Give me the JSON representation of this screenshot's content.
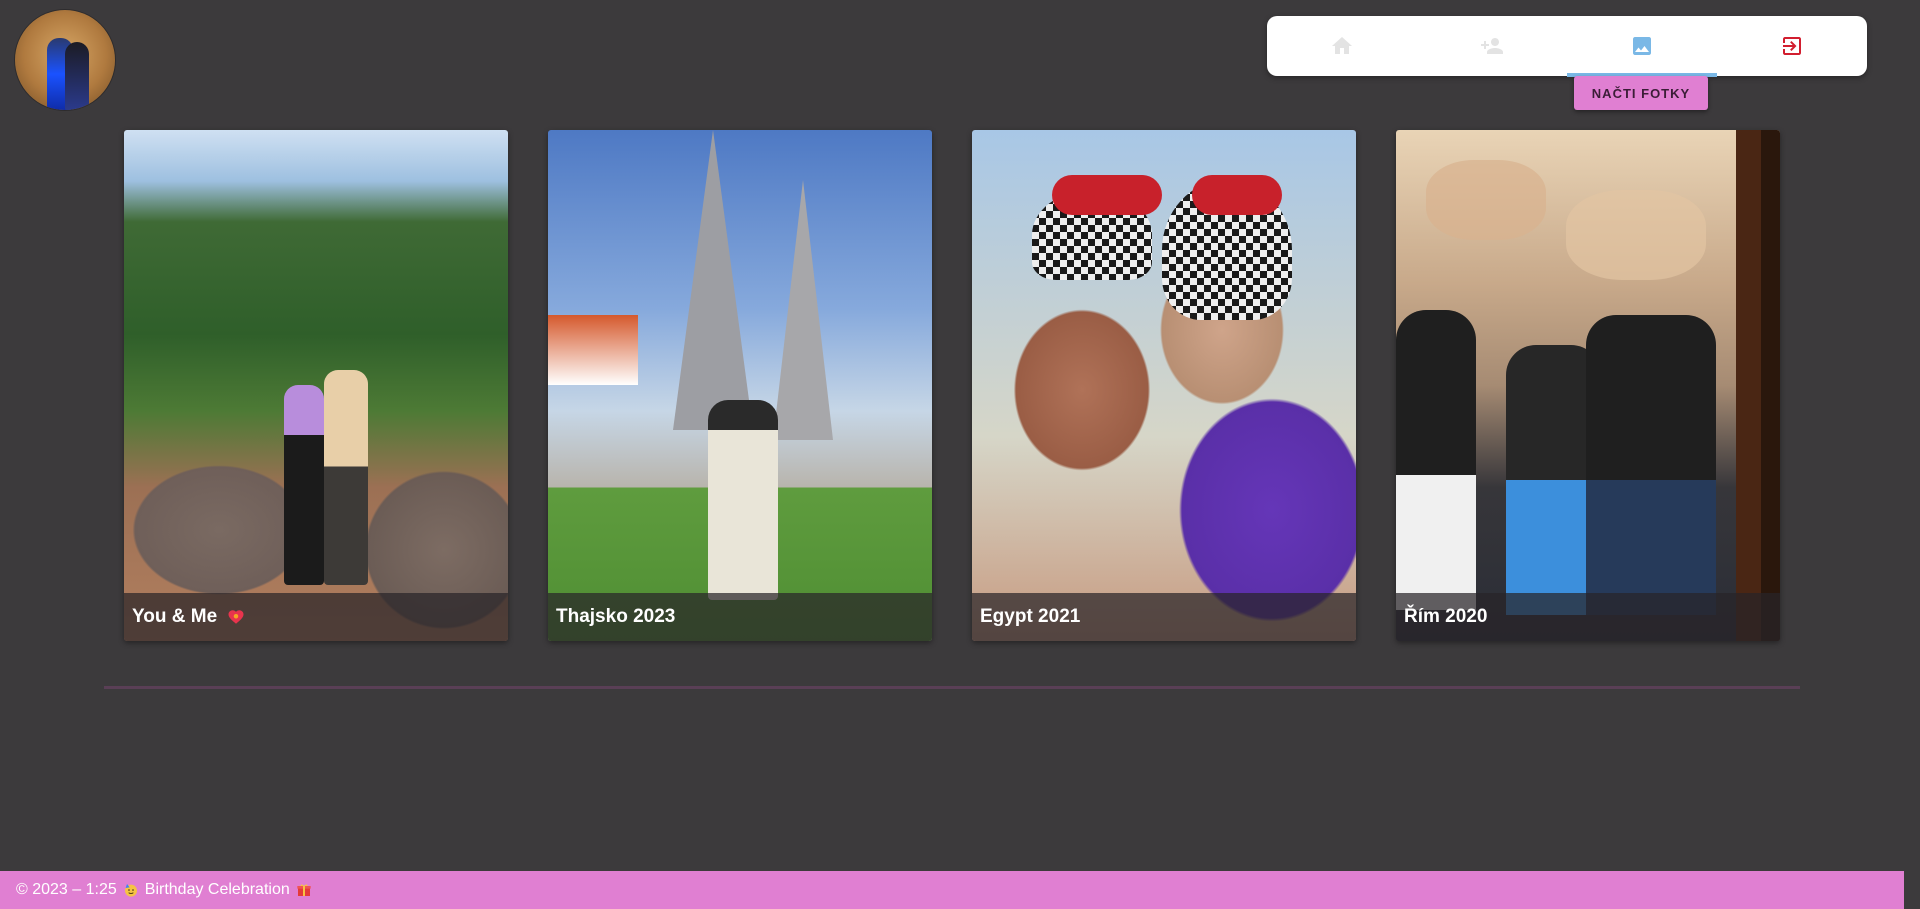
{
  "header": {
    "avatar_alt": "profile avatar"
  },
  "nav": {
    "items": [
      {
        "id": "home",
        "icon": "home-icon",
        "active": false
      },
      {
        "id": "friends",
        "icon": "person-add-icon",
        "active": false
      },
      {
        "id": "photos",
        "icon": "image-icon",
        "active": true
      },
      {
        "id": "logout",
        "icon": "logout-icon",
        "active": false
      }
    ],
    "active_color": "#7ab8e6",
    "logout_color": "#d21e2f"
  },
  "load_button": {
    "label": "NAČTI FOTKY"
  },
  "gallery": {
    "cards": [
      {
        "title": "You & Me",
        "has_heart": true
      },
      {
        "title": "Thajsko 2023",
        "has_heart": false
      },
      {
        "title": "Egypt 2021",
        "has_heart": false
      },
      {
        "title": "Řím 2020",
        "has_heart": false
      }
    ]
  },
  "footer": {
    "copyright": "© 2023 – 1:25",
    "text": "Birthday Celebration",
    "emoji_left": "party-face-icon",
    "emoji_right": "gift-icon",
    "color": "#e07fd2"
  },
  "colors": {
    "background": "#3c3a3c",
    "accent": "#e07fd2"
  }
}
